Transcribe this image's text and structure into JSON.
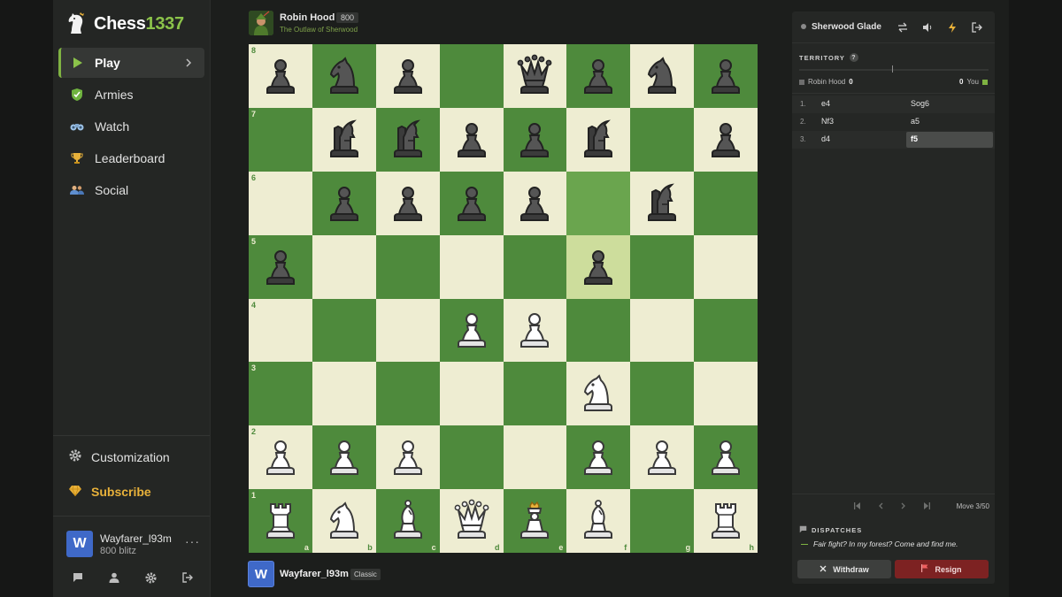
{
  "app": {
    "logo_main": "Chess",
    "logo_accent": "1337"
  },
  "sidebar": {
    "items": [
      {
        "label": "Play",
        "icon": "play-icon",
        "active": true
      },
      {
        "label": "Armies",
        "icon": "shield-icon"
      },
      {
        "label": "Watch",
        "icon": "binoculars-icon"
      },
      {
        "label": "Leaderboard",
        "icon": "trophy-icon"
      },
      {
        "label": "Social",
        "icon": "users-icon"
      }
    ],
    "customization_label": "Customization",
    "subscribe_label": "Subscribe",
    "user": {
      "avatar_letter": "W",
      "name": "Wayfarer_l93m",
      "rating": "800 blitz",
      "more": "···"
    }
  },
  "opponent": {
    "name": "Robin Hood",
    "rating": "800",
    "subtitle": "The Outlaw of Sherwood"
  },
  "player": {
    "avatar_letter": "W",
    "name": "Wayfarer_l93m",
    "tag": "Classic"
  },
  "board": {
    "ranks": [
      "8",
      "7",
      "6",
      "5",
      "4",
      "3",
      "2",
      "1"
    ],
    "files": [
      "a",
      "b",
      "c",
      "d",
      "e",
      "f",
      "g",
      "h"
    ],
    "highlight": [
      "f6",
      "f5"
    ],
    "position": [
      [
        "bP",
        "bN",
        "bP",
        "",
        "bQ",
        "bP",
        "bN",
        "bP"
      ],
      [
        "",
        "bT",
        "bT",
        "bP",
        "bP",
        "bT",
        "",
        "bP"
      ],
      [
        "",
        "bP",
        "bP",
        "bP",
        "bP",
        "",
        "bT",
        ""
      ],
      [
        "bP",
        "",
        "",
        "",
        "",
        "bP",
        "",
        ""
      ],
      [
        "",
        "",
        "",
        "wP",
        "wP",
        "",
        "",
        ""
      ],
      [
        "",
        "",
        "",
        "",
        "",
        "wN",
        "",
        ""
      ],
      [
        "wP",
        "wP",
        "wP",
        "",
        "",
        "wP",
        "wP",
        "wP"
      ],
      [
        "wR",
        "wN",
        "wB",
        "wQ",
        "wK",
        "wB",
        "",
        "wR"
      ]
    ]
  },
  "panel": {
    "room_name": "Sherwood Glade",
    "head_icons": [
      "swap-icon",
      "sound-icon",
      "lightning-icon",
      "exit-icon"
    ],
    "territory_label": "TERRITORY",
    "help": "?",
    "left_player": "Robin Hood",
    "left_score": "0",
    "right_score": "0",
    "right_player": "You",
    "moves": [
      {
        "num": "1.",
        "white": "e4",
        "black": "Sog6"
      },
      {
        "num": "2.",
        "white": "Nf3",
        "black": "a5"
      },
      {
        "num": "3.",
        "white": "d4",
        "black": "f5",
        "current": true
      }
    ],
    "move_count": "Move 3/50",
    "dispatches_label": "DISPATCHES",
    "dispatch_message": "Fair fight? In my forest? Come and find me.",
    "withdraw_label": "Withdraw",
    "resign_label": "Resign"
  },
  "colors": {
    "light_square": "#eeedd2",
    "dark_square": "#4e8a3c",
    "accent": "#7fb342",
    "subscribe": "#e8b13a",
    "resign": "#7d2222",
    "avatar": "#3f69c8"
  }
}
